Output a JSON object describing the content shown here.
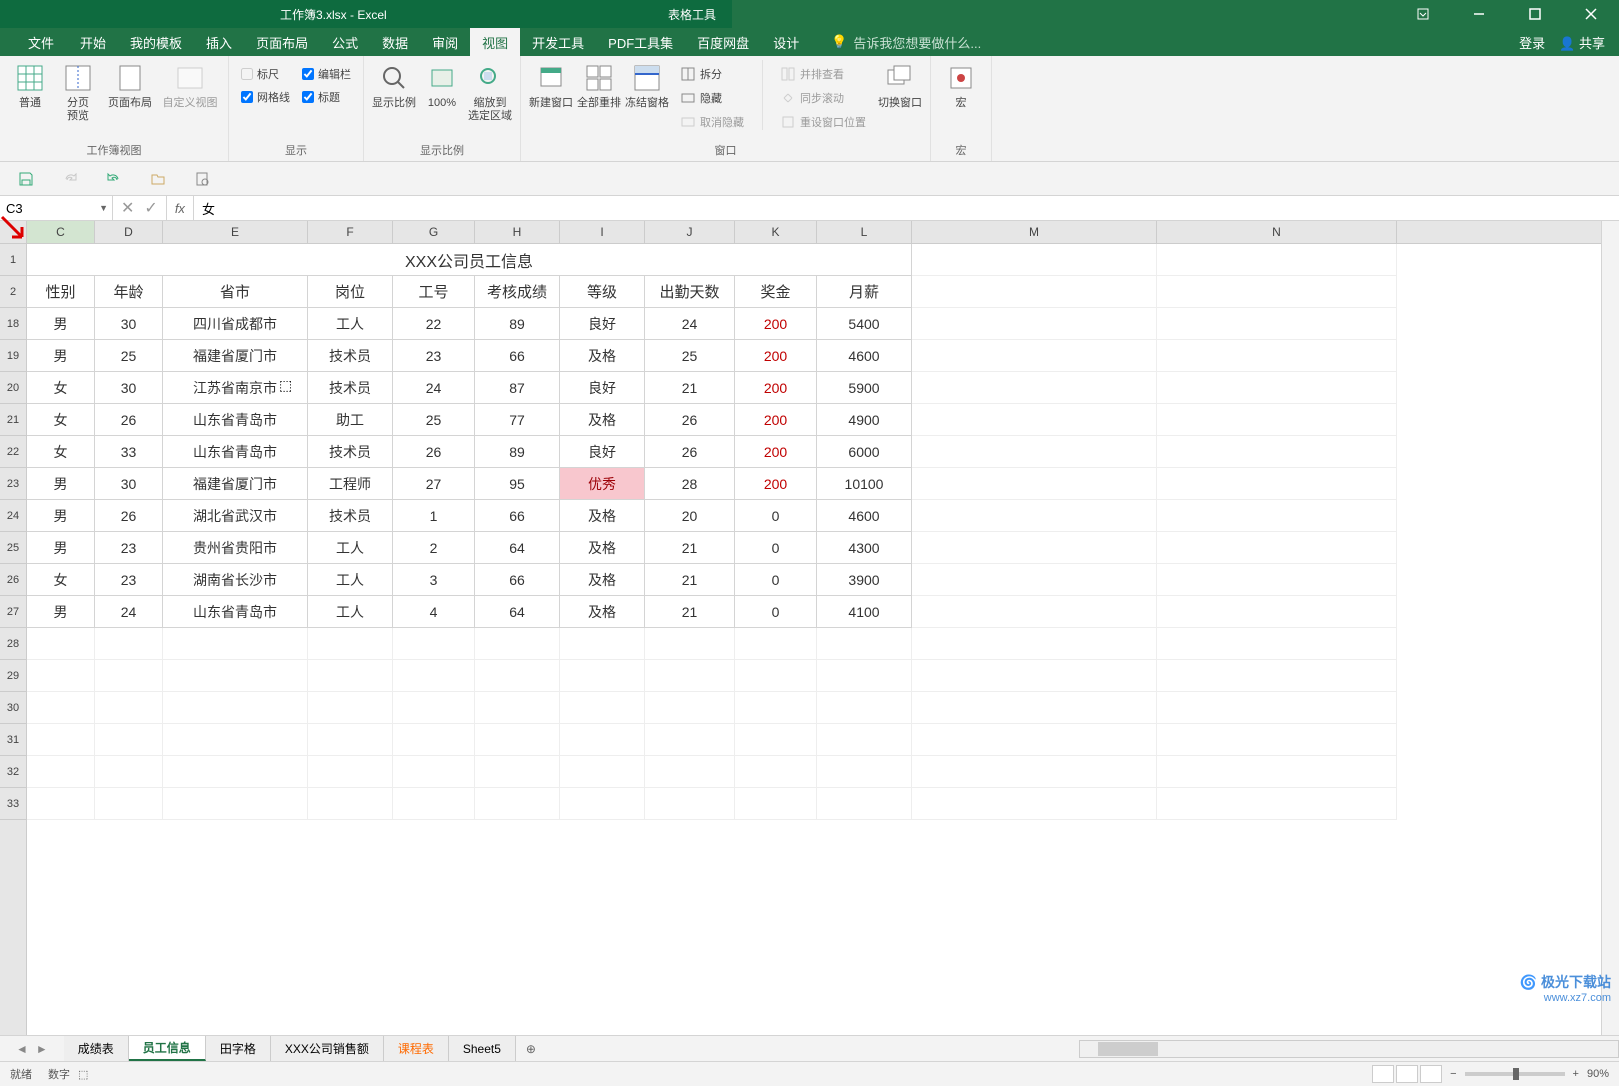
{
  "title_bar": {
    "filename": "工作簿3.xlsx - Excel",
    "tools": "表格工具"
  },
  "menu": {
    "file": "文件",
    "home": "开始",
    "templates": "我的模板",
    "insert": "插入",
    "layout": "页面布局",
    "formulas": "公式",
    "data": "数据",
    "review": "审阅",
    "view": "视图",
    "dev": "开发工具",
    "pdf": "PDF工具集",
    "baidu": "百度网盘",
    "design": "设计",
    "tellme": "告诉我您想要做什么...",
    "login": "登录",
    "share": "共享"
  },
  "ribbon": {
    "g1": {
      "normal": "普通",
      "page_preview": "分页\n预览",
      "page_layout": "页面布局",
      "custom": "自定义视图",
      "label": "工作簿视图"
    },
    "g2": {
      "ruler": "标尺",
      "formula_bar": "编辑栏",
      "gridlines": "网格线",
      "headings": "标题",
      "label": "显示"
    },
    "g3": {
      "zoom": "显示比例",
      "hundred": "100%",
      "zoom_sel": "缩放到\n选定区域",
      "label": "显示比例"
    },
    "g4": {
      "new_win": "新建窗口",
      "arrange": "全部重排",
      "freeze": "冻结窗格",
      "split": "拆分",
      "hide": "隐藏",
      "unhide": "取消隐藏",
      "side": "并排查看",
      "sync": "同步滚动",
      "reset": "重设窗口位置",
      "switch": "切换窗口",
      "label": "窗口"
    },
    "g5": {
      "macro": "宏",
      "label": "宏"
    }
  },
  "namebox": "C3",
  "formula": "女",
  "columns": [
    "C",
    "D",
    "E",
    "F",
    "G",
    "H",
    "I",
    "J",
    "K",
    "L",
    "M",
    "N"
  ],
  "row_numbers": [
    "1",
    "2",
    "18",
    "19",
    "20",
    "21",
    "22",
    "23",
    "24",
    "25",
    "26",
    "27",
    "28",
    "29",
    "30",
    "31",
    "32",
    "33"
  ],
  "table_title": "XXX公司员工信息",
  "headers": [
    "性别",
    "年龄",
    "省市",
    "岗位",
    "工号",
    "考核成绩",
    "等级",
    "出勤天数",
    "奖金",
    "月薪"
  ],
  "rows": [
    {
      "r": "18",
      "d": [
        "男",
        "30",
        "四川省成都市",
        "工人",
        "22",
        "89",
        "良好",
        "24",
        "200",
        "5400"
      ]
    },
    {
      "r": "19",
      "d": [
        "男",
        "25",
        "福建省厦门市",
        "技术员",
        "23",
        "66",
        "及格",
        "25",
        "200",
        "4600"
      ]
    },
    {
      "r": "20",
      "d": [
        "女",
        "30",
        "江苏省南京市",
        "技术员",
        "24",
        "87",
        "良好",
        "21",
        "200",
        "5900"
      ]
    },
    {
      "r": "21",
      "d": [
        "女",
        "26",
        "山东省青岛市",
        "助工",
        "25",
        "77",
        "及格",
        "26",
        "200",
        "4900"
      ]
    },
    {
      "r": "22",
      "d": [
        "女",
        "33",
        "山东省青岛市",
        "技术员",
        "26",
        "89",
        "良好",
        "26",
        "200",
        "6000"
      ]
    },
    {
      "r": "23",
      "d": [
        "男",
        "30",
        "福建省厦门市",
        "工程师",
        "27",
        "95",
        "优秀",
        "28",
        "200",
        "10100"
      ]
    },
    {
      "r": "24",
      "d": [
        "男",
        "26",
        "湖北省武汉市",
        "技术员",
        "1",
        "66",
        "及格",
        "20",
        "0",
        "4600"
      ]
    },
    {
      "r": "25",
      "d": [
        "男",
        "23",
        "贵州省贵阳市",
        "工人",
        "2",
        "64",
        "及格",
        "21",
        "0",
        "4300"
      ]
    },
    {
      "r": "26",
      "d": [
        "女",
        "23",
        "湖南省长沙市",
        "工人",
        "3",
        "66",
        "及格",
        "21",
        "0",
        "3900"
      ]
    },
    {
      "r": "27",
      "d": [
        "男",
        "24",
        "山东省青岛市",
        "工人",
        "4",
        "64",
        "及格",
        "21",
        "0",
        "4100"
      ]
    }
  ],
  "sheets": {
    "s1": "成绩表",
    "s2": "员工信息",
    "s3": "田字格",
    "s4": "XXX公司销售额",
    "s5": "课程表",
    "s6": "Sheet5"
  },
  "status": {
    "ready": "就绪",
    "count": "数字",
    "zoom": "90%"
  },
  "watermark": {
    "l1": "极光下载站",
    "l2": "www.xz7.com"
  }
}
